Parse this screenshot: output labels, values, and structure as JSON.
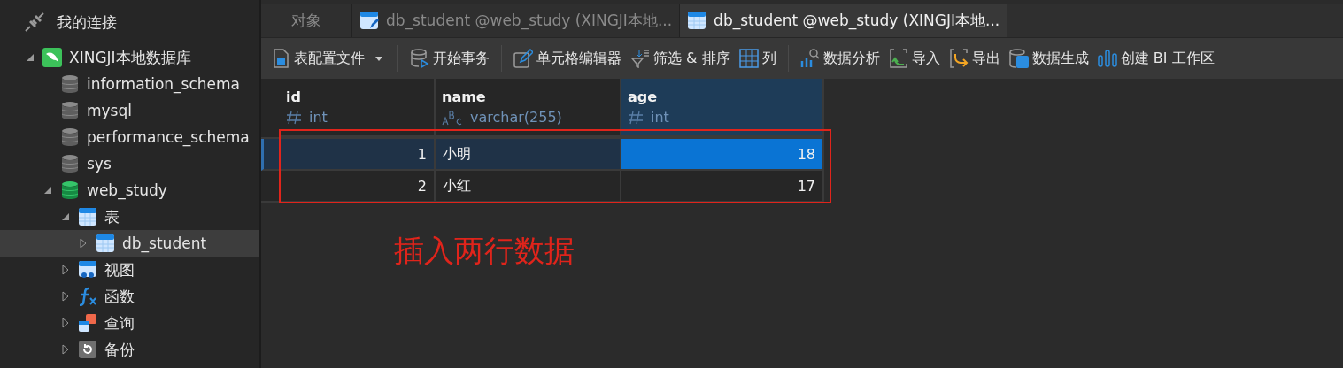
{
  "sidebar": {
    "title": "我的连接",
    "tree": [
      {
        "label": "XINGJI本地数据库",
        "kind": "server",
        "expanded": true,
        "selected": false,
        "children": [
          {
            "label": "information_schema",
            "kind": "database",
            "selected": false
          },
          {
            "label": "mysql",
            "kind": "database",
            "selected": false
          },
          {
            "label": "performance_schema",
            "kind": "database",
            "selected": false
          },
          {
            "label": "sys",
            "kind": "database",
            "selected": false
          },
          {
            "label": "web_study",
            "kind": "database-open",
            "expanded": true,
            "selected": false,
            "children": [
              {
                "label": "表",
                "kind": "tables",
                "expanded": true,
                "selected": false,
                "children": [
                  {
                    "label": "db_student",
                    "kind": "table",
                    "expanded": false,
                    "selected": true
                  }
                ]
              },
              {
                "label": "视图",
                "kind": "views",
                "expanded": false,
                "selected": false
              },
              {
                "label": "函数",
                "kind": "functions",
                "expanded": false,
                "selected": false
              },
              {
                "label": "查询",
                "kind": "queries",
                "expanded": false,
                "selected": false
              },
              {
                "label": "备份",
                "kind": "backups",
                "expanded": false,
                "selected": false
              }
            ]
          }
        ]
      }
    ]
  },
  "tabs": [
    {
      "label": "对象",
      "kind": "plain",
      "selected": false
    },
    {
      "label": "db_student @web_study (XINGJI本地...",
      "kind": "design",
      "selected": false
    },
    {
      "label": "db_student @web_study (XINGJI本地...",
      "kind": "table",
      "selected": true
    }
  ],
  "toolbar": [
    {
      "label": "表配置文件",
      "kind": "profile",
      "dropdown": true
    },
    {
      "kind": "separator"
    },
    {
      "label": "开始事务",
      "kind": "transaction"
    },
    {
      "kind": "separator"
    },
    {
      "label": "单元格编辑器",
      "kind": "edit"
    },
    {
      "label": "筛选 & 排序",
      "kind": "filter"
    },
    {
      "label": "列",
      "kind": "columns"
    },
    {
      "kind": "separator"
    },
    {
      "label": "数据分析",
      "kind": "analysis"
    },
    {
      "label": "导入",
      "kind": "import"
    },
    {
      "label": "导出",
      "kind": "export"
    },
    {
      "label": "数据生成",
      "kind": "generate"
    },
    {
      "label": "创建 BI 工作区",
      "kind": "bi"
    }
  ],
  "table": {
    "columns": [
      {
        "name": "id",
        "type": "int",
        "kind": "number",
        "selected": false
      },
      {
        "name": "name",
        "type": "varchar(255)",
        "kind": "text",
        "selected": false
      },
      {
        "name": "age",
        "type": "int",
        "kind": "number",
        "selected": true
      }
    ],
    "rows": [
      {
        "selected": true,
        "cells": [
          {
            "value": "1",
            "selected": false
          },
          {
            "value": "小明",
            "selected": false
          },
          {
            "value": "18",
            "selected": true
          }
        ]
      },
      {
        "selected": false,
        "cells": [
          {
            "value": "2",
            "selected": false
          },
          {
            "value": "小红",
            "selected": false
          },
          {
            "value": "17",
            "selected": false
          }
        ]
      }
    ]
  },
  "annotation": {
    "text": "插入两行数据"
  }
}
